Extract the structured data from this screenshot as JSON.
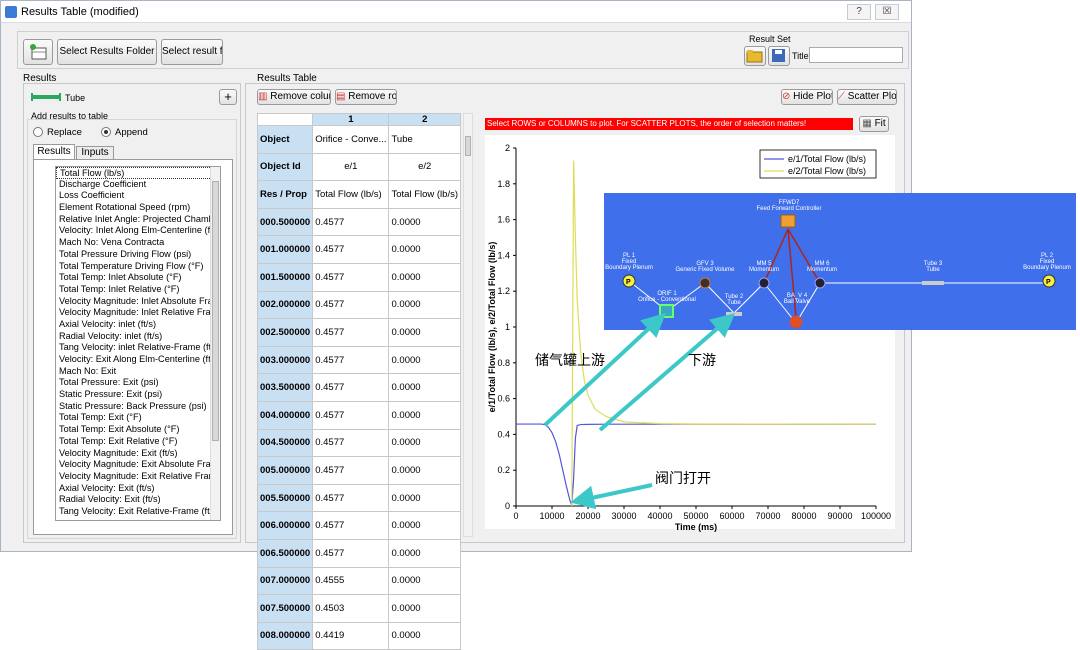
{
  "window": {
    "title": "Results Table (modified)",
    "help_btn": "?",
    "close_btn": "☒"
  },
  "toolbar": {
    "select_folder": "Select Results Folder",
    "select_files": "Select result files"
  },
  "result_set": {
    "label": "Result Set",
    "title_label": "Title",
    "title_value": ""
  },
  "left": {
    "results_label": "Results",
    "tube_label": "Tube",
    "add_label": "Add results to table",
    "replace": "Replace",
    "append": "Append",
    "tabs": [
      "Results",
      "Inputs"
    ],
    "items": [
      "Total Flow (lb/s)",
      "Discharge Coefficient",
      "Loss Coefficient",
      "Element Rotational Speed (rpm)",
      "Relative Inlet Angle: Projected Chamb...",
      "Velocity: Inlet Along Elm-Centerline (f...",
      "Mach No: Vena Contracta",
      "Total Pressure Driving Flow (psi)",
      "Total Temperature Driving Flow (°F)",
      "Total Temp: Inlet Absolute (°F)",
      "Total Temp: Inlet Relative (°F)",
      "Velocity Magnitude: Inlet Absolute Fra...",
      "Velocity Magnitude: Inlet Relative Fra...",
      "Axial Velocity: inlet (ft/s)",
      "Radial Velocity: inlet (ft/s)",
      "Tang Velocity: inlet Relative-Frame (ft...",
      "Velocity: Exit Along Elm-Centerline (ft...",
      "Mach No: Exit",
      "Total Pressure: Exit (psi)",
      "Static Pressure: Exit (psi)",
      "Static Pressure: Back Pressure (psi)",
      "Total Temp: Exit (°F)",
      "Total Temp: Exit Absolute (°F)",
      "Total Temp: Exit Relative (°F)",
      "Velocity Magnitude: Exit (ft/s)",
      "Velocity Magnitude: Exit Absolute Fra...",
      "Velocity Magnitude: Exit Relative Fram...",
      "Axial Velocity: Exit (ft/s)",
      "Radial Velocity: Exit (ft/s)",
      "Tang Velocity: Exit Relative-Frame (ft/s)"
    ]
  },
  "table": {
    "label": "Results Table",
    "remove_column": "Remove column",
    "remove_row": "Remove row",
    "col_nums": [
      "1",
      "2"
    ],
    "object_hdr": "Object",
    "object_vals": [
      "Orifice - Conve...",
      "Tube"
    ],
    "objid_hdr": "Object Id",
    "objid_vals": [
      "e/1",
      "e/2"
    ],
    "resprop_hdr": "Res / Prop",
    "resprop_vals": [
      "Total Flow (lb/s)",
      "Total Flow (lb/s)"
    ],
    "rows": [
      [
        "000.500000",
        "0.4577",
        "0.0000"
      ],
      [
        "001.000000",
        "0.4577",
        "0.0000"
      ],
      [
        "001.500000",
        "0.4577",
        "0.0000"
      ],
      [
        "002.000000",
        "0.4577",
        "0.0000"
      ],
      [
        "002.500000",
        "0.4577",
        "0.0000"
      ],
      [
        "003.000000",
        "0.4577",
        "0.0000"
      ],
      [
        "003.500000",
        "0.4577",
        "0.0000"
      ],
      [
        "004.000000",
        "0.4577",
        "0.0000"
      ],
      [
        "004.500000",
        "0.4577",
        "0.0000"
      ],
      [
        "005.000000",
        "0.4577",
        "0.0000"
      ],
      [
        "005.500000",
        "0.4577",
        "0.0000"
      ],
      [
        "006.000000",
        "0.4577",
        "0.0000"
      ],
      [
        "006.500000",
        "0.4577",
        "0.0000"
      ],
      [
        "007.000000",
        "0.4555",
        "0.0000"
      ],
      [
        "007.500000",
        "0.4503",
        "0.0000"
      ],
      [
        "008.000000",
        "0.4419",
        "0.0000"
      ]
    ]
  },
  "plot": {
    "hide_plot": "Hide Plot",
    "scatter_plot": "Scatter Plot",
    "fit": "Fit",
    "hint": "Select ROWS or COLUMNS to plot. For SCATTER PLOTS, the order of selection matters!"
  },
  "chart_data": {
    "type": "line",
    "xlabel": "Time (ms)",
    "ylabel": "e/1/Total Flow (lb/s), e/2/Total Flow (lb/s)",
    "xlim": [
      0,
      100000
    ],
    "ylim": [
      0,
      2
    ],
    "xticks": [
      "0",
      "10000",
      "20000",
      "30000",
      "40000",
      "50000",
      "60000",
      "70000",
      "80000",
      "90000",
      "100000"
    ],
    "yticks": [
      "0",
      "0.2",
      "0.4",
      "0.6",
      "0.8",
      "1",
      "1.2",
      "1.4",
      "1.6",
      "1.8",
      "2"
    ],
    "legend": "top-right",
    "series": [
      {
        "name": "e/1/Total Flow (lb/s)",
        "color": "#5555dd",
        "x": [
          0,
          7000,
          8000,
          9000,
          10000,
          11000,
          12000,
          13000,
          14000,
          15000,
          15500,
          16000,
          16500,
          17000,
          18000,
          20000,
          25000,
          40000,
          100000
        ],
        "y": [
          0.4577,
          0.4577,
          0.455,
          0.44,
          0.41,
          0.36,
          0.29,
          0.2,
          0.11,
          0.03,
          0.005,
          0.15,
          0.38,
          0.45,
          0.455,
          0.456,
          0.457,
          0.457,
          0.457
        ]
      },
      {
        "name": "e/2/Total Flow (lb/s)",
        "color": "#dddd55",
        "x": [
          15500,
          16000,
          16500,
          17000,
          18000,
          19000,
          20000,
          22000,
          25000,
          30000,
          35000,
          40000,
          50000,
          100000
        ],
        "y": [
          0,
          1.93,
          1.5,
          1.15,
          0.85,
          0.7,
          0.62,
          0.54,
          0.5,
          0.47,
          0.465,
          0.46,
          0.458,
          0.457
        ]
      }
    ]
  },
  "diagram": {
    "ffwd": [
      "FFWD7",
      "Feed Forward Controller"
    ],
    "pl1": [
      "PL 1",
      "Fixed",
      "Boundary Plenum"
    ],
    "gfv": [
      "GFV 3",
      "Generic Fixed Volume"
    ],
    "mm5": [
      "MM 5",
      "Momentum"
    ],
    "mm6": [
      "MM 6",
      "Momentum"
    ],
    "tube3": [
      "Tube 3",
      "Tube"
    ],
    "pl2": [
      "PL 2",
      "Fixed",
      "Boundary Plenum"
    ],
    "orif": [
      "ORIF 1",
      "Orifice - Conventional"
    ],
    "tube2": [
      "Tube 2",
      "Tube"
    ],
    "bv": [
      "BA_V 4",
      "Ball Valve"
    ],
    "p_label": "P"
  },
  "annotations": {
    "upstream": "储气罐上游",
    "downstream": "下游",
    "valve_open": "阀门打开"
  }
}
